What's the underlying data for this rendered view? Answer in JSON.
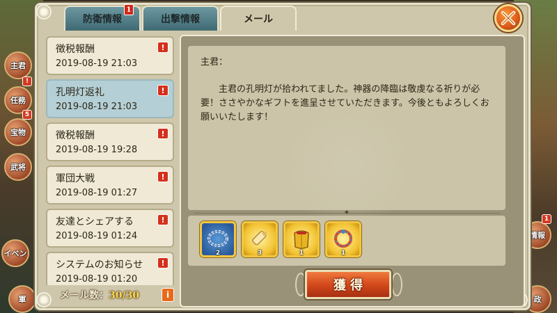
{
  "tabs": [
    {
      "label": "防衛情報",
      "badge": "1"
    },
    {
      "label": "出撃情報"
    },
    {
      "label": "メール"
    }
  ],
  "mails": [
    {
      "title": "徴税報酬",
      "date": "2019-08-19 21:03"
    },
    {
      "title": "孔明灯返礼",
      "date": "2019-08-19 21:03"
    },
    {
      "title": "徴税報酬",
      "date": "2019-08-19 19:28"
    },
    {
      "title": "軍団大戦",
      "date": "2019-08-19 01:27"
    },
    {
      "title": "友達とシェアする",
      "date": "2019-08-19 01:24"
    },
    {
      "title": "システムのお知らせ",
      "date": "2019-08-19 01:20"
    }
  ],
  "unread_mark": "!",
  "mail_count": {
    "label": "メール数：",
    "value": "30/30"
  },
  "info_label": "i",
  "letter": {
    "salutation": "主君：",
    "body": "主君の孔明灯が拾われてました。神器の降臨は敬虔なる祈りが必要！ささやかなギフトを進呈させていただきます。今後ともよろしくお願いいたします！"
  },
  "rewards": [
    {
      "icon": "chain-ring-icon",
      "qty": "2"
    },
    {
      "icon": "scroll-icon",
      "qty": "3"
    },
    {
      "icon": "golden-armor-icon",
      "qty": "1"
    },
    {
      "icon": "jade-ring-icon",
      "qty": "1"
    }
  ],
  "claim_label": "獲得",
  "side_left": [
    {
      "label": "主君",
      "badge": ""
    },
    {
      "label": "任務",
      "badge": "!"
    },
    {
      "label": "宝物",
      "badge": "5"
    },
    {
      "label": "武将",
      "badge": ""
    },
    {
      "label": "イベン",
      "badge": ""
    },
    {
      "label": "軍",
      "badge": ""
    }
  ],
  "side_right": [
    {
      "label": "",
      "badge": ""
    },
    {
      "label": "情報",
      "badge": "1"
    },
    {
      "label": "政",
      "badge": ""
    }
  ]
}
